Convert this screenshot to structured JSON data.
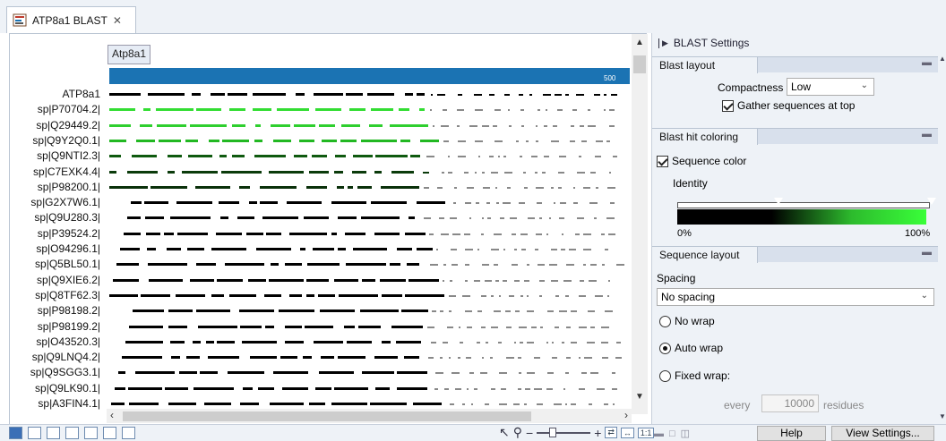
{
  "tab": {
    "title": "ATP8a1 BLAST",
    "close": "✕"
  },
  "viewer": {
    "query_label": "Atp8a1",
    "ruler_end": "500",
    "rows": [
      {
        "name": "ATP8a1",
        "color": "#000000"
      },
      {
        "name": "sp|P70704.2|",
        "color": "#33dd33"
      },
      {
        "name": "sp|Q29449.2|",
        "color": "#2ecf2e"
      },
      {
        "name": "sp|Q9Y2Q0.1|",
        "color": "#22b822"
      },
      {
        "name": "sp|Q9NTI2.3|",
        "color": "#0f5a0f"
      },
      {
        "name": "sp|C7EXK4.4|",
        "color": "#0b3b0b"
      },
      {
        "name": "sp|P98200.1|",
        "color": "#0a300a"
      },
      {
        "name": "sp|G2X7W6.1|",
        "color": "#000000"
      },
      {
        "name": "sp|Q9U280.3|",
        "color": "#000000"
      },
      {
        "name": "sp|P39524.2|",
        "color": "#000000"
      },
      {
        "name": "sp|O94296.1|",
        "color": "#000000"
      },
      {
        "name": "sp|Q5BL50.1|",
        "color": "#000000"
      },
      {
        "name": "sp|Q9XIE6.2|",
        "color": "#000000"
      },
      {
        "name": "sp|Q8TF62.3|",
        "color": "#000000"
      },
      {
        "name": "sp|P98198.2|",
        "color": "#000000"
      },
      {
        "name": "sp|P98199.2|",
        "color": "#000000"
      },
      {
        "name": "sp|O43520.3|",
        "color": "#000000"
      },
      {
        "name": "sp|Q9LNQ4.2|",
        "color": "#000000"
      },
      {
        "name": "sp|Q9SGG3.1|",
        "color": "#000000"
      },
      {
        "name": "sp|Q9LK90.1|",
        "color": "#000000"
      },
      {
        "name": "sp|A3FIN4.1|",
        "color": "#000000"
      }
    ]
  },
  "panel": {
    "title": "BLAST Settings",
    "blast_layout": {
      "header": "Blast layout",
      "compactness_label": "Compactness",
      "compactness_value": "Low",
      "gather_label": "Gather sequences at top"
    },
    "hit_coloring": {
      "header": "Blast hit coloring",
      "sequence_color_label": "Sequence color",
      "identity_label": "Identity",
      "min_label": "0%",
      "max_label": "100%"
    },
    "sequence_layout": {
      "header": "Sequence layout",
      "spacing_label": "Spacing",
      "spacing_value": "No spacing",
      "no_wrap": "No wrap",
      "auto_wrap": "Auto wrap",
      "fixed_wrap": "Fixed wrap:",
      "every_label": "every",
      "every_value": "10000",
      "residues_label": "residues"
    }
  },
  "bottom": {
    "help": "Help",
    "view_settings": "View Settings..."
  }
}
